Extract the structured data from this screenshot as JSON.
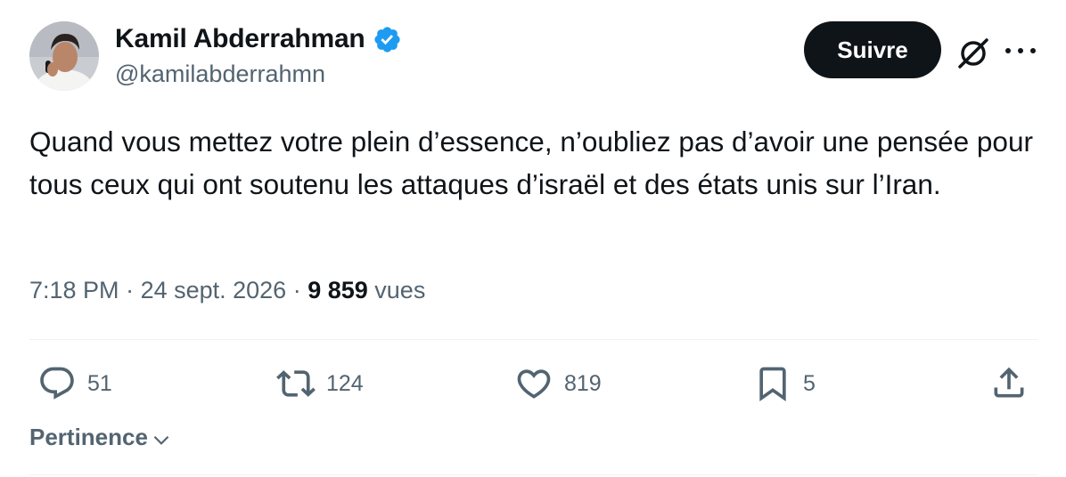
{
  "author": {
    "display_name": "Kamil Abderrahman",
    "handle": "@kamilabderrahmn",
    "verified": true
  },
  "header": {
    "follow_label": "Suivre",
    "grok_icon": "grok-icon",
    "more_icon": "more-icon"
  },
  "tweet": {
    "text": "Quand vous mettez votre plein d’essence, n’oubliez pas d’avoir une pensée pour tous ceux qui ont soutenu les attaques d’israël et des états unis sur l’Iran.",
    "time": "7:18 PM",
    "sep1": " · ",
    "date": "24 sept. 2026",
    "sep2": " · ",
    "views_count": "9 859",
    "views_label": " vues"
  },
  "actions": {
    "replies": "51",
    "reposts": "124",
    "likes": "819",
    "bookmarks": "5"
  },
  "sort": {
    "label": "Pertinence"
  },
  "colors": {
    "text": "#0f1419",
    "secondary": "#536471",
    "verified": "#1d9bf0",
    "button_bg": "#0f1419",
    "divider": "#eff3f4"
  }
}
